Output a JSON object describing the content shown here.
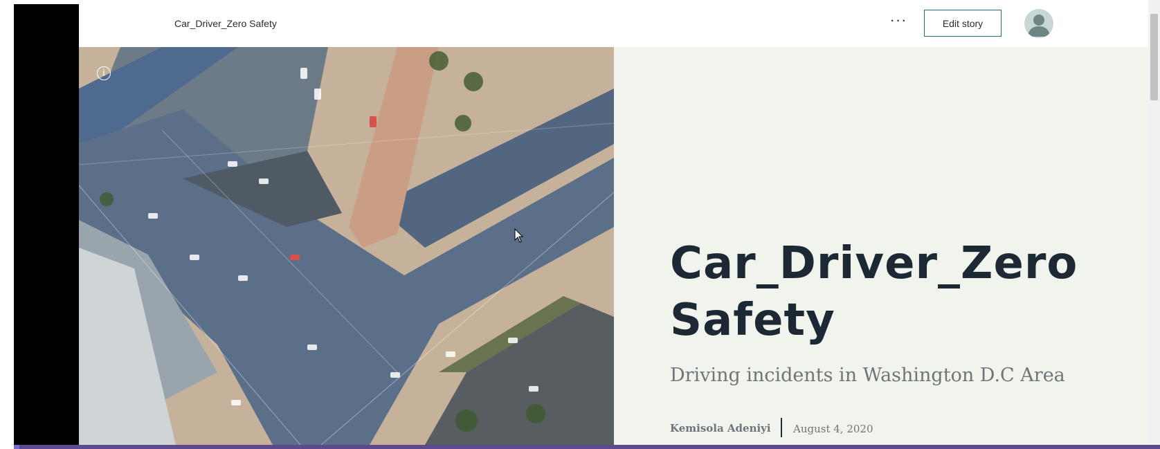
{
  "header": {
    "story_title": "Car_Driver_Zero Safety",
    "more_label": "···",
    "edit_button_label": "Edit story"
  },
  "hero": {
    "info_icon_glyph": "i",
    "image_description_icon": "info-icon"
  },
  "story": {
    "title_line1": "Car_Driver_Zero",
    "title_line2": "Safety",
    "subtitle": "Driving incidents in Washington D.C Area",
    "author": "Kemisola Adeniyi",
    "date": "August 4, 2020"
  },
  "colors": {
    "accent": "#1d6e84",
    "title": "#1c2934",
    "panel_background": "#f1f3ed",
    "muted_text": "#6e7478"
  }
}
